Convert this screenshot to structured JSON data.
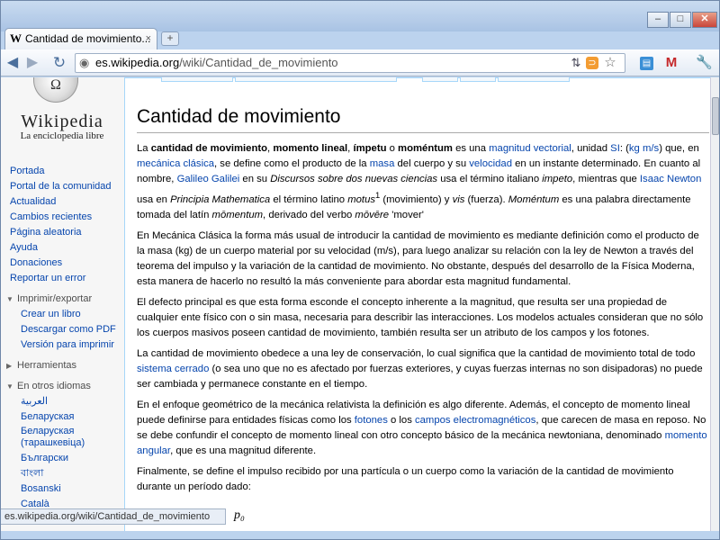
{
  "browser": {
    "tab_title": "Cantidad de movimiento...",
    "tab_icon": "W",
    "tab_close": "×",
    "new_tab": "+",
    "url_host": "es.wikipedia.org",
    "url_path": "/wiki/Cantidad_de_movimiento",
    "status_url": "es.wikipedia.org/wiki/Cantidad_de_movimiento",
    "min_glyph": "–",
    "max_glyph": "□",
    "close_glyph": "✕",
    "back_glyph": "◀",
    "forward_glyph": "▶",
    "reload_glyph": "↻",
    "star_glyph": "☆",
    "gmail_glyph": "M",
    "wrench_glyph": "🔧",
    "translate_glyph": "⇅",
    "rss_glyph": "⊃",
    "ext_glyph": "▤",
    "globe_glyph": "◉"
  },
  "logo": {
    "wordmark": "Wikipedia",
    "tagline": "La enciclopedia libre",
    "puzzle_glyph": "Ω"
  },
  "sidebar": {
    "nav": [
      "Portada",
      "Portal de la comunidad",
      "Actualidad",
      "Cambios recientes",
      "Página aleatoria",
      "Ayuda",
      "Donaciones",
      "Reportar un error"
    ],
    "print_header": "Imprimir/exportar",
    "print_links": [
      "Crear un libro",
      "Descargar como PDF",
      "Versión para imprimir"
    ],
    "tools_header": "Herramientas",
    "lang_header": "En otros idiomas",
    "langs": [
      "العربية",
      "Беларуская",
      "Беларуская (тарашкевіца)",
      "Български",
      "বাংলা",
      "Bosanski",
      "Català"
    ]
  },
  "article": {
    "title": "Cantidad de movimiento",
    "p1": {
      "t1": "La ",
      "b1": "cantidad de movimiento",
      "t2": ", ",
      "b2": "momento lineal",
      "t3": ", ",
      "b3": "ímpetu",
      "t4": " o ",
      "b4": "moméntum",
      "t5": " es una ",
      "l1": "magnitud vectorial",
      "t6": ", unidad ",
      "l2": "SI",
      "t7": ": (",
      "l3": "kg m/s",
      "t8": ") que, en ",
      "l4": "mecánica clásica",
      "t9": ", se define como el producto de la ",
      "l5": "masa",
      "t10": " del cuerpo y su ",
      "l6": "velocidad",
      "t11": " en un instante determinado. En cuanto al nombre, ",
      "l7": "Galileo Galilei",
      "t12": " en su ",
      "i1": "Discursos sobre dos nuevas ciencias",
      "t13": " usa el término italiano ",
      "i2": "impeto",
      "t14": ", mientras que ",
      "l8": "Isaac Newton",
      "t15": " usa en ",
      "i3": "Principia Mathematica",
      "t16": " el término latino ",
      "i4": "motus",
      "sup": "1",
      "t17": " (movimiento) y ",
      "i5": "vis",
      "t18": " (fuerza). ",
      "i6": "Moméntum",
      "t19": " es una palabra directamente tomada del latín ",
      "i7": "mōmentum",
      "t20": ", derivado del verbo ",
      "i8": "mōvēre",
      "t21": " 'mover'"
    },
    "p2": "En Mecánica Clásica la forma más usual de introducir la cantidad de movimiento es mediante definición como el producto de la masa (kg) de un cuerpo material por su velocidad (m/s), para luego analizar su relación con la ley de Newton a través del teorema del impulso y la variación de la cantidad de movimiento. No obstante, después del desarrollo de la Física Moderna, esta manera de hacerlo no resultó la más conveniente para abordar esta magnitud fundamental.",
    "p3": "El defecto principal es que esta forma esconde el concepto inherente a la magnitud, que resulta ser una propiedad de cualquier ente físico con o sin masa, necesaria para describir las interacciones. Los modelos actuales consideran que no sólo los cuerpos masivos poseen cantidad de movimiento, también resulta ser un atributo de los campos y los fotones.",
    "p4": {
      "t1": "La cantidad de movimiento obedece a una ley de conservación, lo cual significa que la cantidad de movimiento total de todo ",
      "l1": "sistema cerrado",
      "t2": " (o sea uno que no es afectado por fuerzas exteriores, y cuyas fuerzas internas no son disipadoras) no puede ser cambiada y permanece constante en el tiempo."
    },
    "p5": {
      "t1": "En el enfoque geométrico de la mecánica relativista la definición es algo diferente. Además, el concepto de momento lineal puede definirse para entidades físicas como los ",
      "l1": "fotones",
      "t2": " o los ",
      "l2": "campos electromagnéticos",
      "t3": ", que carecen de masa en reposo. No se debe confundir el concepto de momento lineal con otro concepto básico de la mecánica newtoniana, denominado ",
      "l3": "momento angular",
      "t4": ", que es una magnitud diferente."
    },
    "p6": "Finalmente, se define el impulso recibido por una partícula o un cuerpo como la variación de la cantidad de movimiento durante un período dado:",
    "formula": "p₀"
  }
}
